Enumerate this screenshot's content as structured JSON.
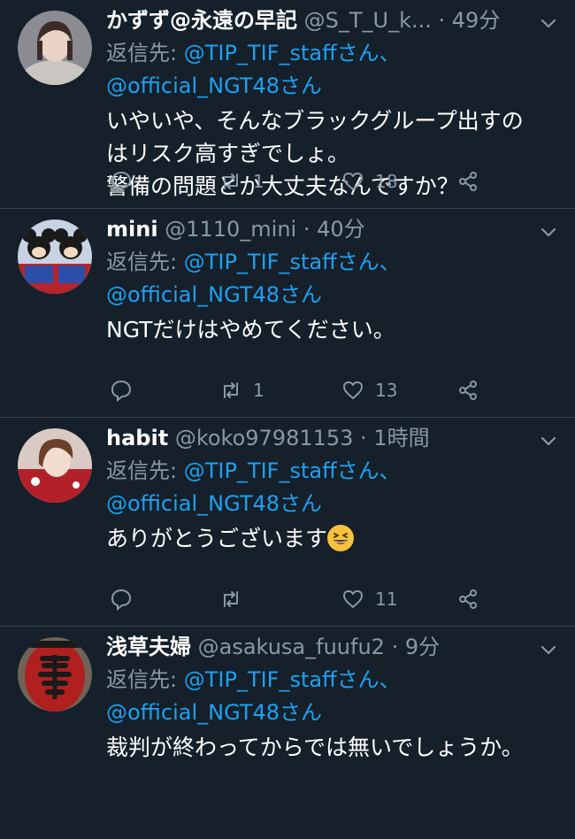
{
  "tweets": [
    {
      "name": "かずず@永遠の早記",
      "handle": "@S_T_U_k...",
      "time": "49分",
      "replying_prefix": "返信先: ",
      "mention1": "@TIP_TIF_staffさん、",
      "mention2": "@official_NGT48さん",
      "lines": [
        "いやいや、そんなブラックグループ出すの",
        "はリスク高すぎでしょ。",
        "警備の問題とか大丈夫なんですか？"
      ],
      "retweets": "1",
      "likes": "18",
      "avatar_icon": "user-photo"
    },
    {
      "name": "mini",
      "handle": "@1110_mini",
      "time": "40分",
      "replying_prefix": "返信先: ",
      "mention1": "@TIP_TIF_staffさん、",
      "mention2": "@official_NGT48さん",
      "lines": [
        "NGTだけはやめてください。"
      ],
      "retweets": "1",
      "likes": "13",
      "avatar_icon": "mouse-characters"
    },
    {
      "name": "habit",
      "handle": "@koko97981153",
      "time": "1時間",
      "replying_prefix": "返信先: ",
      "mention1": "@TIP_TIF_staffさん、",
      "mention2": "@official_NGT48さん",
      "lines": [
        "ありがとうございます"
      ],
      "emoji": "grinning-squinting-face",
      "retweets": "",
      "likes": "11",
      "avatar_icon": "user-photo"
    },
    {
      "name": "浅草夫婦",
      "handle": "@asakusa_fuufu2",
      "time": "9分",
      "replying_prefix": "返信先: ",
      "mention1": "@TIP_TIF_staffさん、",
      "mention2": "@official_NGT48さん",
      "lines": [
        "裁判が終わってからでは無いでしょうか。"
      ],
      "avatar_icon": "lantern"
    }
  ],
  "separator": " · ",
  "colors": {
    "background": "#15202b",
    "secondary_text": "#8899a6",
    "link": "#1da1f2",
    "divider": "#38444d"
  }
}
